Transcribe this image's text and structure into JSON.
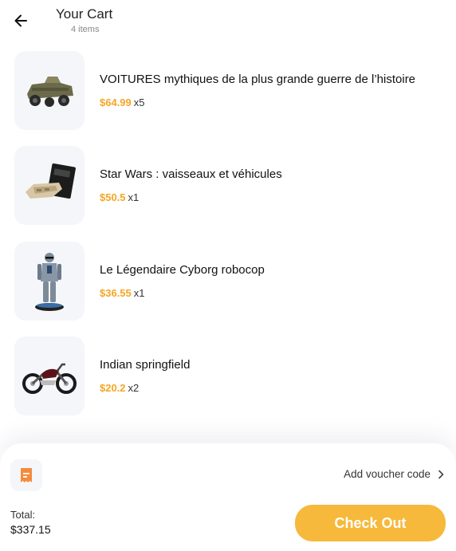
{
  "header": {
    "title": "Your Cart",
    "subtitle": "4 items"
  },
  "items": [
    {
      "name": "VOITURES mythiques de la plus grande guerre de l’histoire",
      "price": "$64.99",
      "quantity": "x5",
      "image_icon": "military-jeep-model"
    },
    {
      "name": "Star Wars : vaisseaux et véhicules",
      "price": "$50.5",
      "quantity": "x1",
      "image_icon": "starship-model-with-magazine"
    },
    {
      "name": "Le Légendaire Cyborg robocop",
      "price": "$36.55",
      "quantity": "x1",
      "image_icon": "robocop-figure"
    },
    {
      "name": "Indian springfield",
      "price": "$20.2",
      "quantity": "x2",
      "image_icon": "motorcycle-model"
    }
  ],
  "footer": {
    "voucher_label": "Add voucher code",
    "total_label": "Total:",
    "total_value": "$337.15",
    "checkout_label": "Check Out"
  },
  "colors": {
    "accent": "#f6b93b",
    "price": "#f5a623",
    "voucher_icon": "#f58a3c",
    "thumb_bg": "#f5f6f9"
  }
}
